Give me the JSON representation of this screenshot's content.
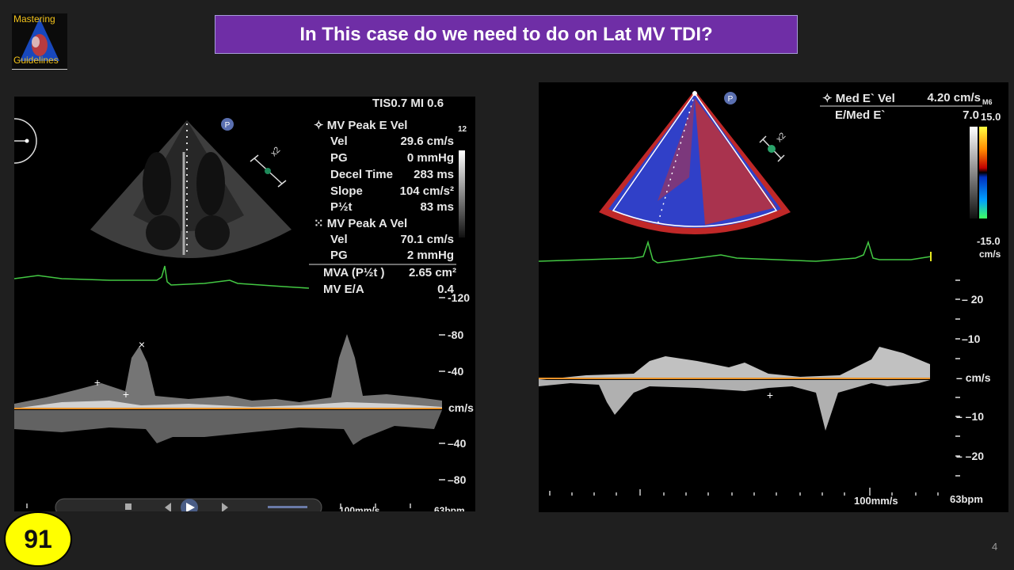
{
  "logo": {
    "line1": "Mastering",
    "line2": "Guidelines"
  },
  "title": "In This case do we need to do on Lat MV TDI?",
  "left": {
    "header": "TIS0.7   MI 0.6",
    "probe_label": "P",
    "zoom_label": "x2",
    "side_value": "12",
    "e_wave_title": "MV Peak E Vel",
    "e_rows": [
      {
        "label": "Vel",
        "value": "29.6 cm/s"
      },
      {
        "label": "PG",
        "value": "0 mmHg"
      },
      {
        "label": "Decel Time",
        "value": "283 ms"
      },
      {
        "label": "Slope",
        "value": "104 cm/s²"
      },
      {
        "label": "P½t",
        "value": "83 ms"
      }
    ],
    "a_wave_title": "MV Peak A Vel",
    "a_rows": [
      {
        "label": "Vel",
        "value": "70.1 cm/s"
      },
      {
        "label": "PG",
        "value": "2 mmHg"
      }
    ],
    "mva_label": "MVA (P½t )",
    "mva_value": "2.65 cm²",
    "ea_label": "MV E/A",
    "ea_value": "0.4",
    "ticks": [
      "-120",
      "-80",
      "-40",
      "cm/s",
      "–40",
      "–80"
    ],
    "bottom_speed": "100mm/s",
    "bottom_bpm": "63bpm"
  },
  "right": {
    "probe_label": "P",
    "zoom_label": "x2",
    "med_e_label": "Med E` Vel",
    "med_e_value": "4.20 cm/s",
    "ratio_label": "E/Med E`",
    "ratio_value": "7.0",
    "scale_top": "15.0",
    "scale_bottom": "-15.0",
    "scale_unit": "cm/s",
    "mark": "M6",
    "ticks": [
      "20",
      "10",
      "cm/s",
      "10",
      "20"
    ],
    "bottom_speed": "100mm/s",
    "bottom_bpm": "63bpm"
  },
  "badge": "91",
  "slide_number": "4",
  "colors": {
    "banner": "#6f2ea6",
    "badge": "#ffff00",
    "ecg": "#43c843",
    "baseline": "#e8922a"
  }
}
